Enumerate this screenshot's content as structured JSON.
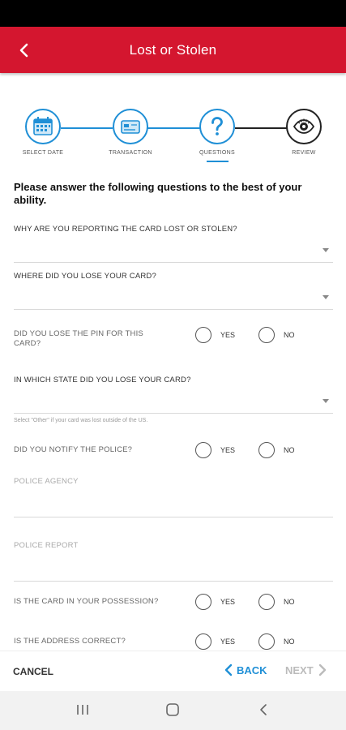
{
  "appbar": {
    "title": "Lost or Stolen"
  },
  "stepper": {
    "steps": [
      {
        "label": "SELECT DATE",
        "icon": "calendar-icon"
      },
      {
        "label": "TRANSACTION",
        "icon": "card-icon"
      },
      {
        "label": "QUESTIONS",
        "icon": "question-icon"
      },
      {
        "label": "REVIEW",
        "icon": "eye-icon"
      }
    ],
    "active_color": "#1f8fd6"
  },
  "form": {
    "instructions": "Please answer the following questions to the best of your ability.",
    "q_reason": "WHY ARE YOU REPORTING THE CARD LOST OR STOLEN?",
    "q_where": "WHERE DID YOU LOSE YOUR CARD?",
    "q_pin": "DID YOU LOSE THE PIN FOR THIS CARD?",
    "q_state": "IN WHICH STATE DID YOU LOSE YOUR CARD?",
    "state_hint": "Select \"Other\" if your card was lost outside of the US.",
    "q_police": "DID YOU NOTIFY THE POLICE?",
    "police_agency_placeholder": "POLICE AGENCY",
    "police_report_placeholder": "POLICE REPORT",
    "q_possession": "IS THE CARD IN YOUR POSSESSION?",
    "q_address": "IS THE ADDRESS CORRECT?",
    "yes": "YES",
    "no": "NO"
  },
  "footer": {
    "cancel": "CANCEL",
    "back": "BACK",
    "next": "NEXT"
  },
  "colors": {
    "brand": "#d4162f",
    "accent": "#1f8fd6"
  }
}
